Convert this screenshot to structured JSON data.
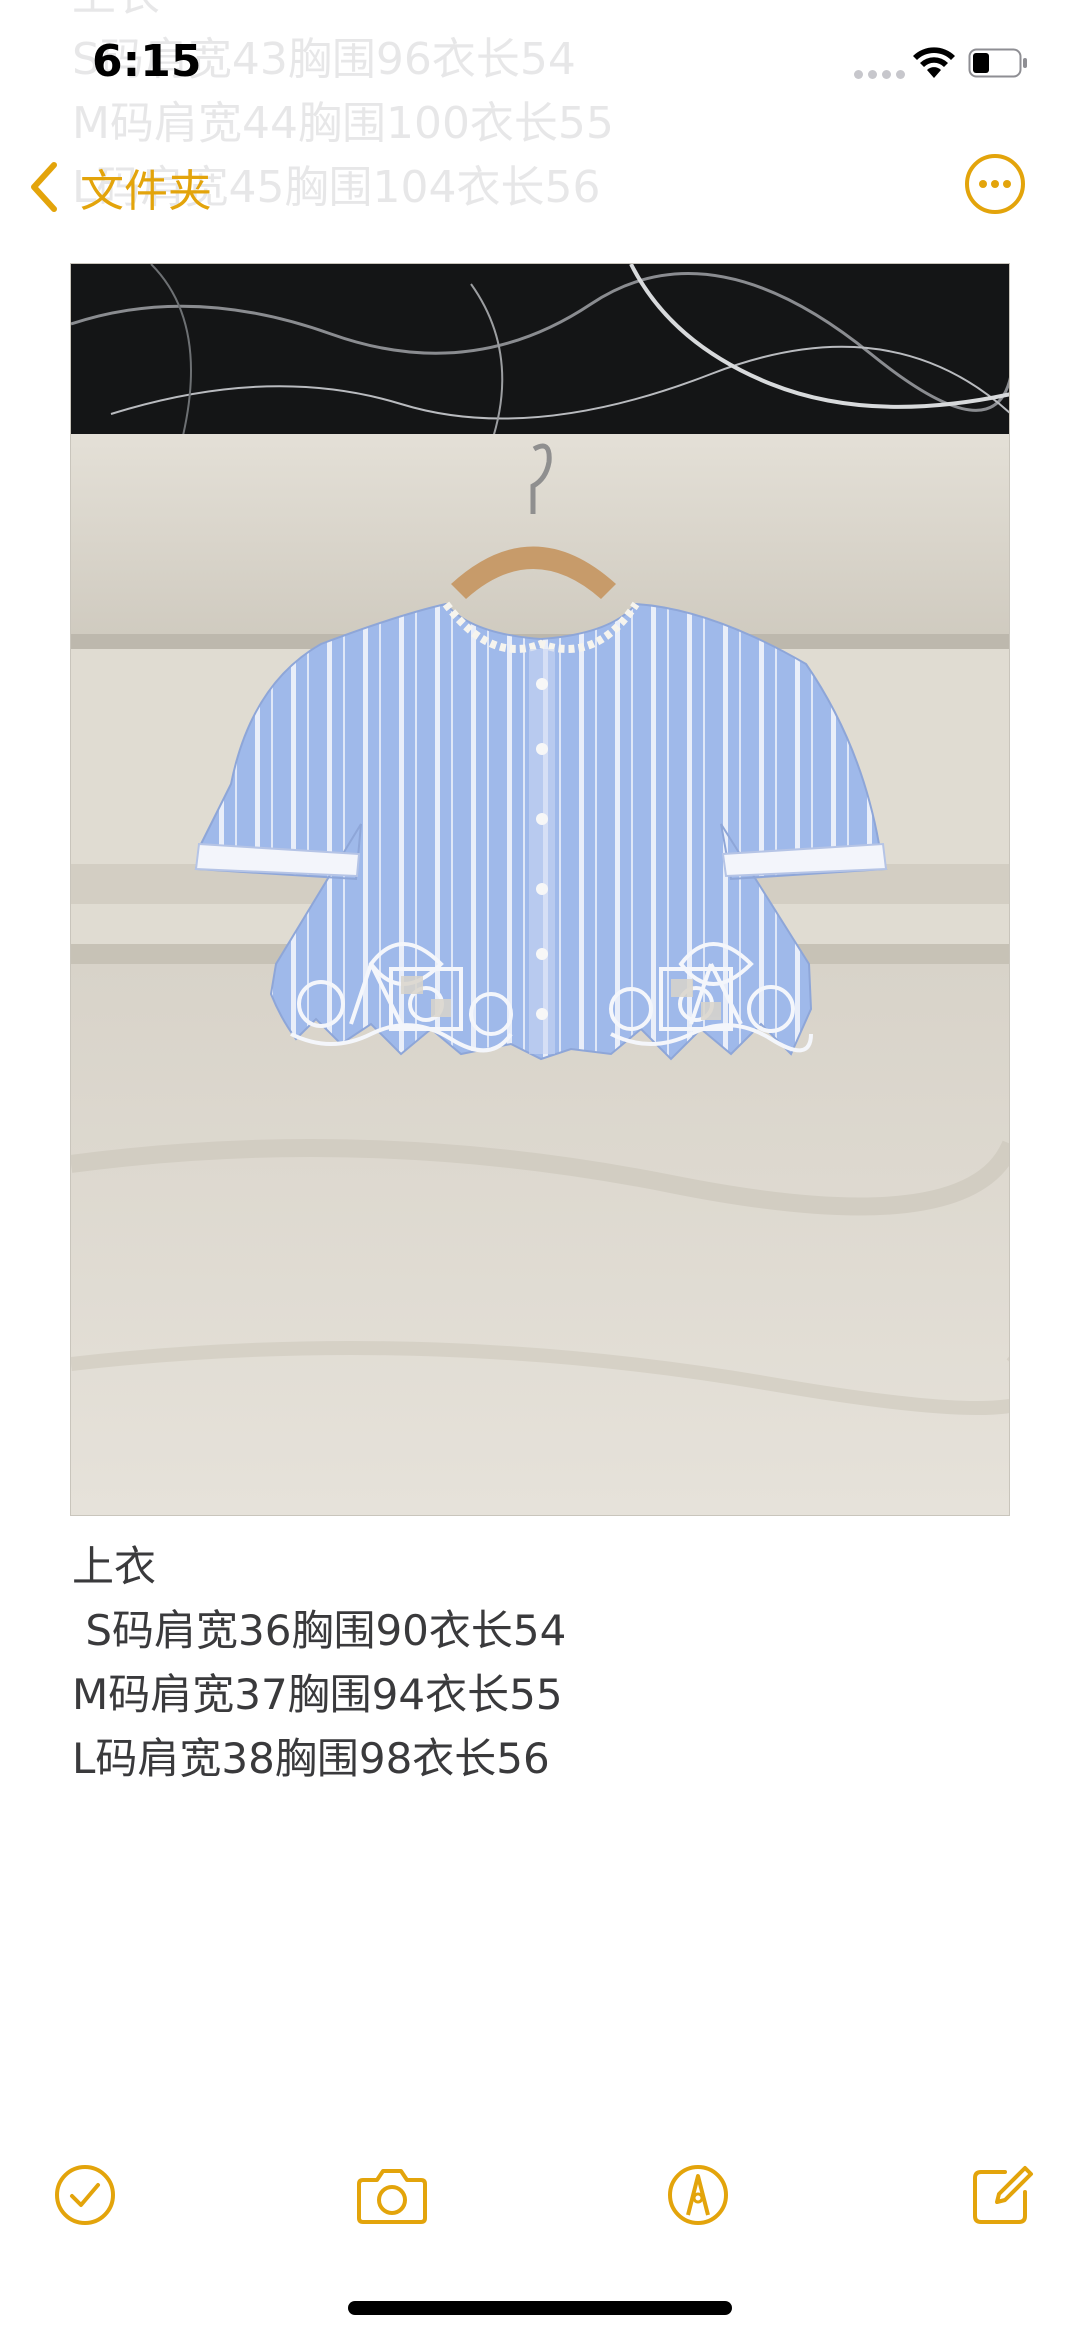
{
  "status_bar": {
    "time": "6:15"
  },
  "nav": {
    "back_label": "文件夹"
  },
  "ghost_lines": [
    "上衣",
    "S码肩宽43胸围96衣长54",
    "M码肩宽44胸围100衣长55",
    "L码肩宽45胸围104衣长56"
  ],
  "note": {
    "lines": [
      "上衣",
      " S码肩宽36胸围90衣长54",
      "M码肩宽37胸围94衣长55",
      "L码肩宽38胸围98衣长56"
    ]
  },
  "colors": {
    "accent": "#e3a40b",
    "text": "#3a3a3c"
  },
  "icons": {
    "back": "chevron-left-icon",
    "more": "ellipsis-circle-icon",
    "checklist": "checkmark-circle-icon",
    "camera": "camera-icon",
    "markup": "pen-tip-circle-icon",
    "compose": "compose-icon"
  }
}
